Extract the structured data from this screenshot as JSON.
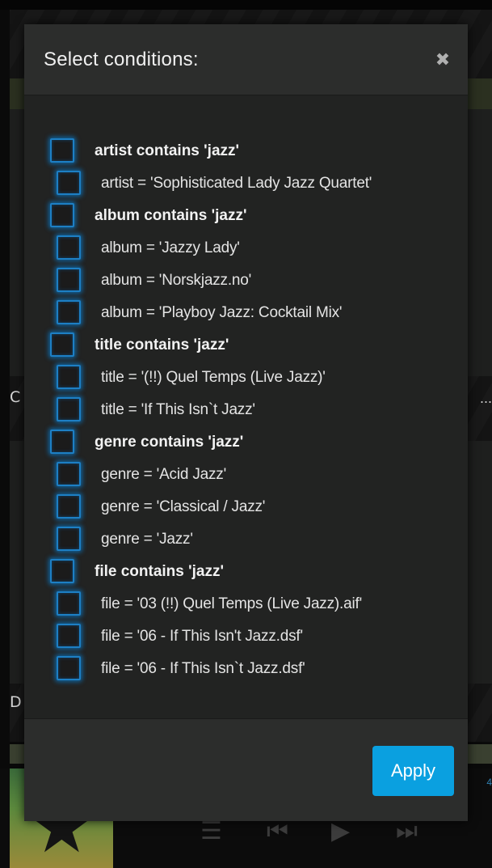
{
  "modal": {
    "title": "Select conditions:",
    "close_icon": "close-icon",
    "apply_label": "Apply",
    "accent_color": "#0aa0e0",
    "checkbox_glow_color": "#1d7fc4",
    "conditions": [
      {
        "type": "group",
        "label": "artist contains 'jazz'",
        "checked": false
      },
      {
        "type": "item",
        "label": "artist = 'Sophisticated Lady Jazz Quartet'",
        "checked": false
      },
      {
        "type": "group",
        "label": "album contains 'jazz'",
        "checked": false
      },
      {
        "type": "item",
        "label": "album = 'Jazzy Lady'",
        "checked": false
      },
      {
        "type": "item",
        "label": "album = 'Norskjazz.no'",
        "checked": false
      },
      {
        "type": "item",
        "label": "album = 'Playboy Jazz: Cocktail Mix'",
        "checked": false
      },
      {
        "type": "group",
        "label": "title contains 'jazz'",
        "checked": false
      },
      {
        "type": "item",
        "label": "title = '(!!) Quel Temps (Live Jazz)'",
        "checked": false
      },
      {
        "type": "item",
        "label": "title = 'If This Isn`t Jazz'",
        "checked": false
      },
      {
        "type": "group",
        "label": "genre contains 'jazz'",
        "checked": false
      },
      {
        "type": "item",
        "label": "genre = 'Acid Jazz'",
        "checked": false
      },
      {
        "type": "item",
        "label": "genre = 'Classical / Jazz'",
        "checked": false
      },
      {
        "type": "item",
        "label": "genre = 'Jazz'",
        "checked": false
      },
      {
        "type": "group",
        "label": "file contains 'jazz'",
        "checked": false
      },
      {
        "type": "item",
        "label": "file = '03 (!!) Quel Temps (Live Jazz).aif'",
        "checked": false
      },
      {
        "type": "item",
        "label": "file = '06 - If This Isn't Jazz.dsf'",
        "checked": false
      },
      {
        "type": "item",
        "label": "file = '06 - If This Isn`t Jazz.dsf'",
        "checked": false
      }
    ]
  },
  "background": {
    "edge_text_1": "C",
    "edge_text_2": "D",
    "ellipsis": "...",
    "time_fragment": "4"
  }
}
